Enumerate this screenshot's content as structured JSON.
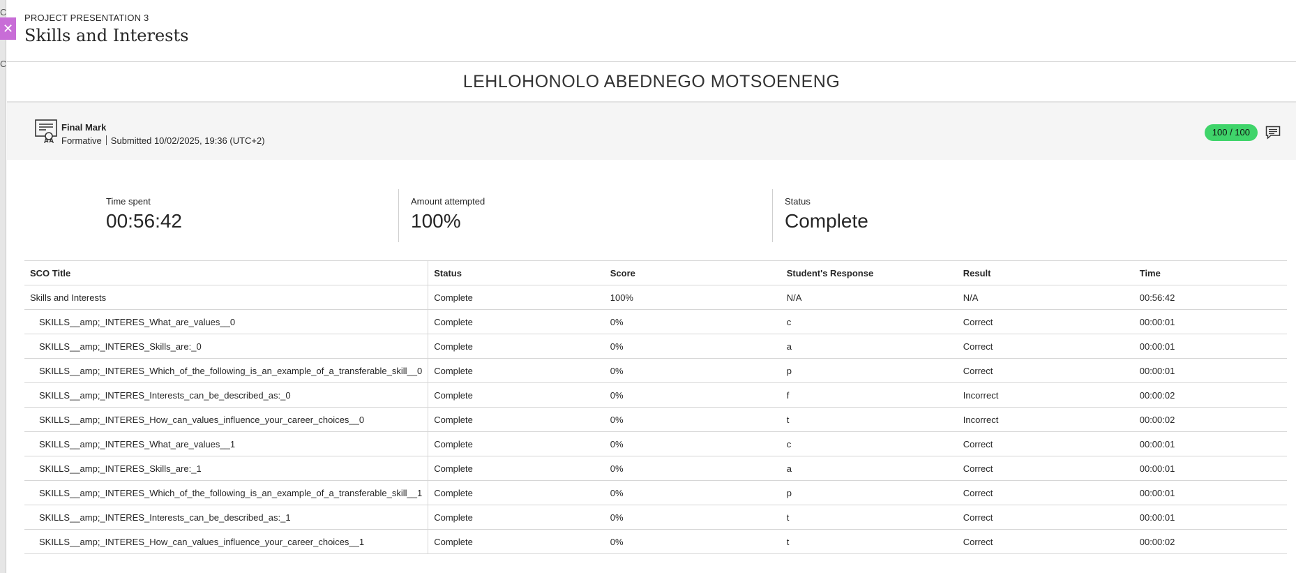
{
  "background": {
    "letters": [
      "C",
      "C"
    ]
  },
  "close_button": {
    "icon": "close-icon",
    "glyph": "✕"
  },
  "header": {
    "eyebrow": "PROJECT PRESENTATION 3",
    "title": "Skills and Interests"
  },
  "student": {
    "name": "LEHLOHONOLO ABEDNEGO MOTSOENENG"
  },
  "grade": {
    "icon": "certificate-icon",
    "name": "Final Mark",
    "type": "Formative",
    "submitted": "Submitted 10/02/2025, 19:36 (UTC+2)",
    "score": "100 / 100",
    "score_color": "#3fd46a",
    "feedback_icon": "feedback-icon"
  },
  "stats": {
    "time_spent": {
      "label": "Time spent",
      "value": "00:56:42"
    },
    "amount_attempted": {
      "label": "Amount attempted",
      "value": "100%"
    },
    "status": {
      "label": "Status",
      "value": "Complete"
    }
  },
  "table": {
    "headers": [
      "SCO Title",
      "Status",
      "Score",
      "Student's Response",
      "Result",
      "Time"
    ],
    "rows": [
      [
        "Skills and Interests",
        "Complete",
        "100%",
        "N/A",
        "N/A",
        "00:56:42"
      ],
      [
        "SKILLS__amp;_INTERES_What_are_values__0",
        "Complete",
        "0%",
        "c",
        "Correct",
        "00:00:01"
      ],
      [
        "SKILLS__amp;_INTERES_Skills_are:_0",
        "Complete",
        "0%",
        "a",
        "Correct",
        "00:00:01"
      ],
      [
        "SKILLS__amp;_INTERES_Which_of_the_following_is_an_example_of_a_transferable_skill__0",
        "Complete",
        "0%",
        "p",
        "Correct",
        "00:00:01"
      ],
      [
        "SKILLS__amp;_INTERES_Interests_can_be_described_as:_0",
        "Complete",
        "0%",
        "f",
        "Incorrect",
        "00:00:02"
      ],
      [
        "SKILLS__amp;_INTERES_How_can_values_influence_your_career_choices__0",
        "Complete",
        "0%",
        "t",
        "Incorrect",
        "00:00:02"
      ],
      [
        "SKILLS__amp;_INTERES_What_are_values__1",
        "Complete",
        "0%",
        "c",
        "Correct",
        "00:00:01"
      ],
      [
        "SKILLS__amp;_INTERES_Skills_are:_1",
        "Complete",
        "0%",
        "a",
        "Correct",
        "00:00:01"
      ],
      [
        "SKILLS__amp;_INTERES_Which_of_the_following_is_an_example_of_a_transferable_skill__1",
        "Complete",
        "0%",
        "p",
        "Correct",
        "00:00:01"
      ],
      [
        "SKILLS__amp;_INTERES_Interests_can_be_described_as:_1",
        "Complete",
        "0%",
        "t",
        "Correct",
        "00:00:01"
      ],
      [
        "SKILLS__amp;_INTERES_How_can_values_influence_your_career_choices__1",
        "Complete",
        "0%",
        "t",
        "Correct",
        "00:00:02"
      ]
    ]
  }
}
